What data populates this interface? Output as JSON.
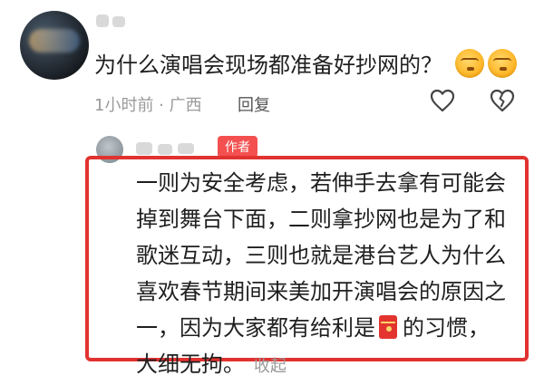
{
  "comment": {
    "text": "为什么演唱会现场都准备好抄网的？",
    "emoji_icon": "tongue-face-emoji-icon",
    "time_location": "1小时前 · 广西",
    "reply_label": "回复",
    "like_icon": "heart-icon",
    "dislike_icon": "broken-heart-icon"
  },
  "reply": {
    "author_badge": "作者",
    "lines": [
      "一则为安全考虑，若伸手去拿有可能会",
      "掉到舞台下面，二则拿抄网也是为了和",
      "歌迷互动，三则也就是港台艺人为什么",
      "喜欢春节期间来美加开演唱会的原因之",
      "一，因为大家都有给利是",
      "的习惯，",
      "大细无拘。"
    ],
    "red_packet_icon": "red-packet-icon",
    "collapse_label": "收起",
    "highlight_color": "#e1322f"
  }
}
